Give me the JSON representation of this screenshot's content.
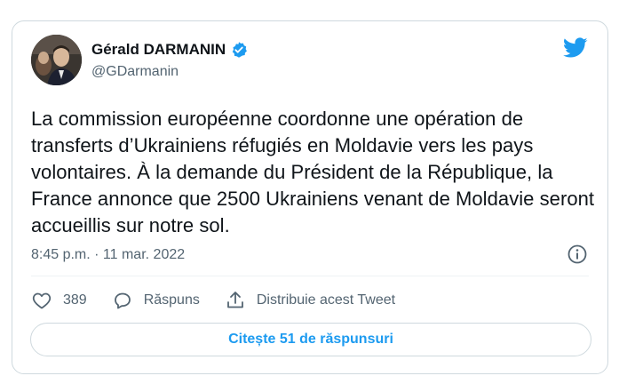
{
  "author": {
    "name": "Gérald DARMANIN",
    "handle": "@GDarmanin"
  },
  "tweet": {
    "text": "La commission européenne coordonne une opération de transferts d’Ukrainiens réfugiés en Moldavie vers les pays volontaires. À la demande du Président de la République, la France annonce que 2500 Ukrainiens venant de Moldavie seront accueillis sur notre sol.",
    "timestamp": "8:45 p.m. · 11 mar. 2022"
  },
  "actions": {
    "like_count": "389",
    "reply_label": "Răspuns",
    "share_label": "Distribuie acest Tweet"
  },
  "read_replies": "Citește 51 de răspunsuri",
  "colors": {
    "brand": "#1d9bf0",
    "text": "#0f1419",
    "secondary": "#536471",
    "border": "#cfd9de"
  },
  "icons": {
    "verified": "verified-badge-icon",
    "logo": "twitter-bird-icon",
    "info": "info-icon",
    "like": "heart-icon",
    "reply": "speech-bubble-icon",
    "share": "share-upload-icon"
  }
}
